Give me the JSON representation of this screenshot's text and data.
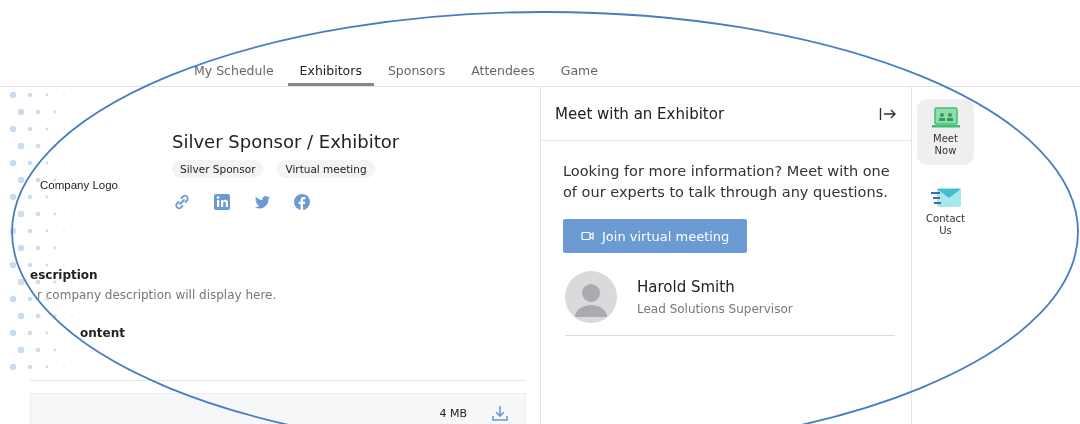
{
  "tabs": [
    {
      "label": "My Schedule",
      "selected": false
    },
    {
      "label": "Exhibitors",
      "selected": true
    },
    {
      "label": "Sponsors",
      "selected": false
    },
    {
      "label": "Attendees",
      "selected": false
    },
    {
      "label": "Game",
      "selected": false
    }
  ],
  "exhibitor": {
    "logo_label": "Company Logo",
    "title": "Silver Sponsor / Exhibitor",
    "tags": [
      "Silver Sponsor",
      "Virtual meeting"
    ],
    "social_links": [
      {
        "kind": "link"
      },
      {
        "kind": "linkedin"
      },
      {
        "kind": "twitter"
      },
      {
        "kind": "facebook"
      }
    ]
  },
  "description": {
    "heading": "escription",
    "text": "r company description will display here."
  },
  "content": {
    "heading": "ontent",
    "file": {
      "size": "4 MB"
    }
  },
  "meet_panel": {
    "title": "Meet with an Exhibitor",
    "intro": "Looking for more information? Meet with one of our experts to talk through any questions.",
    "button": "Join virtual meeting",
    "contact": {
      "name": "Harold Smith",
      "role": "Lead Solutions Supervisor"
    }
  },
  "side_rail": [
    {
      "kind": "meet",
      "label": "Meet Now",
      "selected": true
    },
    {
      "kind": "contact",
      "label": "Contact Us",
      "selected": false
    }
  ]
}
